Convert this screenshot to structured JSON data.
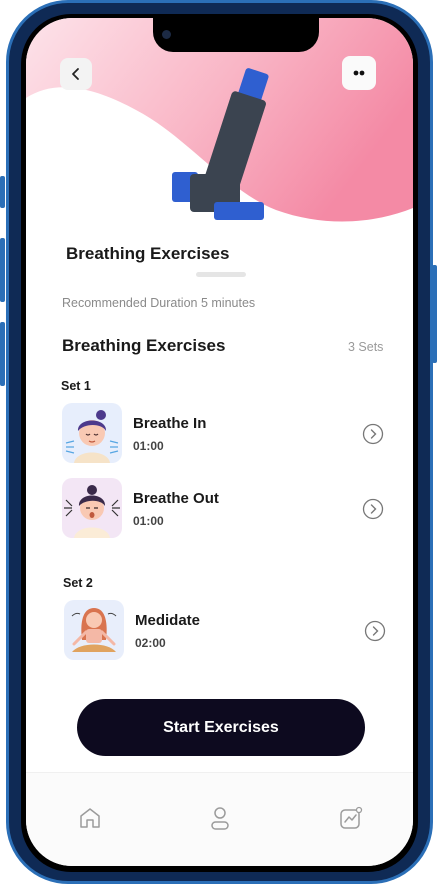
{
  "header": {
    "title": "Breathing Exercises",
    "recommended_duration": "Recommended Duration 5 minutes"
  },
  "section": {
    "title": "Breathing Exercises",
    "sets_count": "3 Sets"
  },
  "sets": [
    {
      "label": "Set 1",
      "exercises": [
        {
          "name": "Breathe In",
          "duration": "01:00",
          "thumb_bg": "#e7eefc"
        },
        {
          "name": "Breathe Out",
          "duration": "01:00",
          "thumb_bg": "#f3e6f5"
        }
      ]
    },
    {
      "label": "Set 2",
      "exercises": [
        {
          "name": "Medidate",
          "duration": "02:00",
          "thumb_bg": "#e8eefb"
        }
      ]
    }
  ],
  "cta": {
    "label": "Start Exercises"
  },
  "tabs": [
    {
      "icon": "home-icon"
    },
    {
      "icon": "profile-icon"
    },
    {
      "icon": "stats-icon"
    }
  ],
  "colors": {
    "accent_pink": "#f58ca6",
    "cta_bg": "#0d0a1f",
    "inhaler_blue": "#2f5fd0",
    "inhaler_gray": "#3b4450",
    "frame": "#2b6fb7"
  }
}
